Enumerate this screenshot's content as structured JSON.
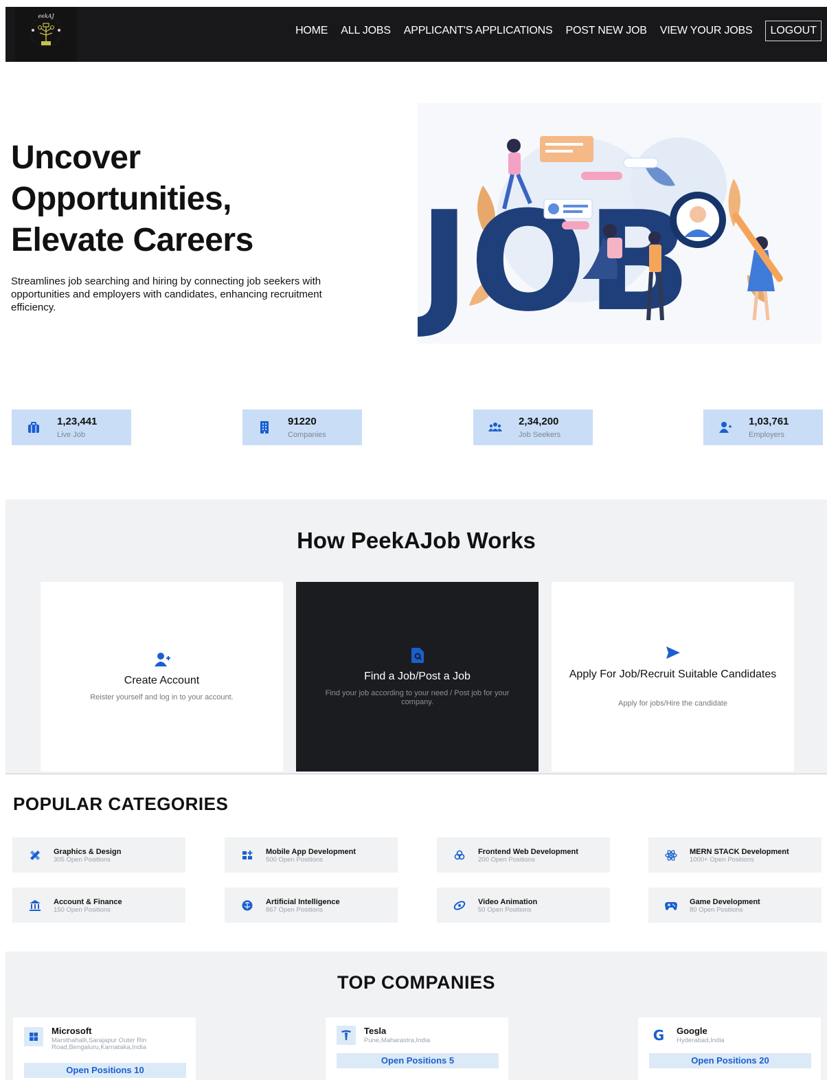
{
  "nav": {
    "logo_text": "PeekAJob",
    "links": [
      "HOME",
      "ALL JOBS",
      "APPLICANT'S APPLICATIONS",
      "POST NEW JOB",
      "VIEW YOUR JOBS"
    ],
    "logout": "LOGOUT"
  },
  "hero": {
    "title_lines": [
      "Uncover",
      "Opportunities,",
      "Elevate Careers"
    ],
    "description": "Streamlines job searching and hiring by connecting job seekers with opportunities and employers with candidates, enhancing recruitment efficiency.",
    "art_word": "JOB"
  },
  "stats": [
    {
      "icon": "briefcase-icon",
      "value": "1,23,441",
      "label": "Live Job"
    },
    {
      "icon": "building-icon",
      "value": "91220",
      "label": "Companies"
    },
    {
      "icon": "users-icon",
      "value": "2,34,200",
      "label": "Job Seekers"
    },
    {
      "icon": "user-plus-icon",
      "value": "1,03,761",
      "label": "Employers"
    }
  ],
  "how": {
    "title": "How PeekAJob Works",
    "cards": [
      {
        "icon": "user-plus-icon",
        "title": "Create Account",
        "desc": "Reister yourself and log in to your account."
      },
      {
        "icon": "file-search-icon",
        "title": "Find a Job/Post a Job",
        "desc": "Find your job according to your need / Post job for your company."
      },
      {
        "icon": "send-icon",
        "title": "Apply For Job/Recruit Suitable Candidates",
        "desc": "Apply for jobs/Hire the candidate"
      }
    ]
  },
  "categories": {
    "title": "POPULAR CATEGORIES",
    "items": [
      {
        "icon": "pen-ruler-icon",
        "name": "Graphics & Design",
        "count": "305 Open Positions"
      },
      {
        "icon": "apps-icon",
        "name": "Mobile App Development",
        "count": "500 Open Positions"
      },
      {
        "icon": "webpack-icon",
        "name": "Frontend Web Development",
        "count": "200 Open Positions"
      },
      {
        "icon": "react-icon",
        "name": "MERN STACK Development",
        "count": "1000+ Open Positions"
      },
      {
        "icon": "bank-icon",
        "name": "Account & Finance",
        "count": "150 Open Positions"
      },
      {
        "icon": "brain-icon",
        "name": "Artificial Intelligence",
        "count": "867 Open Positions"
      },
      {
        "icon": "video-icon",
        "name": "Video Animation",
        "count": "50 Open Positions"
      },
      {
        "icon": "gamepad-icon",
        "name": "Game Development",
        "count": "80 Open Positions"
      }
    ]
  },
  "companies": {
    "title": "TOP COMPANIES",
    "items": [
      {
        "icon": "microsoft-icon",
        "name": "Microsoft",
        "location": "Marsthahalli,Sarajapur Outer Rin Road,Bengaluru,Karnataka,India",
        "open": "Open Positions 10"
      },
      {
        "icon": "tesla-icon",
        "name": "Tesla",
        "location": "Pune,Maharastra,India",
        "open": "Open Positions 5"
      },
      {
        "icon": "google-icon",
        "name": "Google",
        "location": "Hyderabad,India",
        "open": "Open Positions 20"
      }
    ]
  },
  "colors": {
    "nav_bg": "#18181b",
    "accent": "#1a5fcf",
    "stat_bg": "#c9ddf6",
    "section_bg": "#f1f2f4",
    "dark_card": "#1b1c20"
  }
}
